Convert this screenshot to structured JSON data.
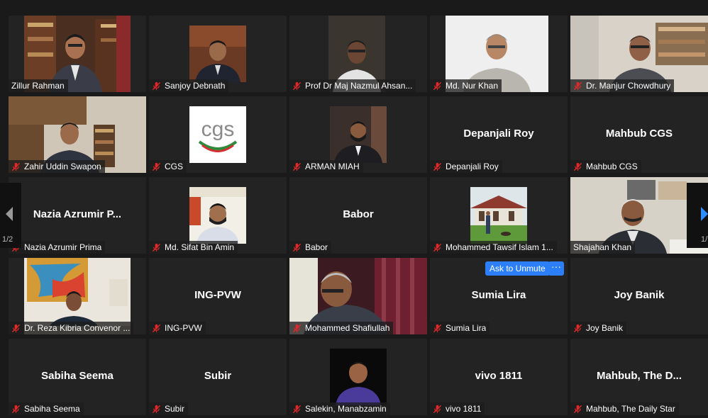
{
  "participants": [
    {
      "name": "Zillur Rahman",
      "muted": false,
      "video": "bookshelf"
    },
    {
      "name": "Sanjoy Debnath",
      "muted": true,
      "video": "portrait"
    },
    {
      "name": "Prof Dr Maj Nazmul Ahsan...",
      "muted": true,
      "video": "dark"
    },
    {
      "name": "Md. Nur Khan",
      "muted": true,
      "video": "light"
    },
    {
      "name": "Dr. Manjur Chowdhury",
      "muted": true,
      "video": "room"
    },
    {
      "name": "Zahir Uddin Swapon",
      "muted": true,
      "video": "bookshelf2"
    },
    {
      "name": "CGS",
      "muted": true,
      "video": "logo"
    },
    {
      "name": "ARMAN MIAH",
      "muted": true,
      "video": "portrait2"
    },
    {
      "name": "Depanjali Roy",
      "display_name": "Depanjali Roy",
      "muted": true
    },
    {
      "name": "Mahbub CGS",
      "display_name": "Mahbub CGS",
      "muted": true
    },
    {
      "name": "Nazia Azrumir Prima",
      "display_name": "Nazia Azrumir P...",
      "muted": true
    },
    {
      "name": "Md. Sifat Bin Amin",
      "muted": true,
      "video": "banner"
    },
    {
      "name": "Babor",
      "display_name": "Babor",
      "muted": true
    },
    {
      "name": "Mohammed Tawsif Islam 1...",
      "muted": true,
      "video": "outdoor"
    },
    {
      "name": "Shajahan Khan",
      "muted": false,
      "video": "office",
      "active": true
    },
    {
      "name": "Dr. Reza Kibria Convenor ...",
      "muted": true,
      "video": "painting"
    },
    {
      "name": "ING-PVW",
      "display_name": "ING-PVW",
      "muted": true
    },
    {
      "name": "Mohammed Shafiullah",
      "muted": true,
      "video": "curtain"
    },
    {
      "name": "Sumia Lira",
      "display_name": "Sumia Lira",
      "muted": true,
      "hover": true
    },
    {
      "name": "Joy Banik",
      "display_name": "Joy Banik",
      "muted": true
    },
    {
      "name": "Sabiha Seema",
      "display_name": "Sabiha Seema",
      "muted": true
    },
    {
      "name": "Subir",
      "display_name": "Subir",
      "muted": true
    },
    {
      "name": "Salekin, Manabzamin",
      "muted": true,
      "video": "portrait3"
    },
    {
      "name": "vivo 1811",
      "display_name": "vivo 1811",
      "muted": true
    },
    {
      "name": "Mahbub, The Daily Star",
      "display_name": "Mahbub, The D...",
      "muted": true
    }
  ],
  "logo_text": "cgs",
  "hover_actions": {
    "ask_to_unmute": "Ask to Unmute",
    "more": "···"
  },
  "pager": {
    "left": "1/2",
    "right": "1/"
  },
  "colors": {
    "active_border": "#c8d95a",
    "button_blue": "#2d7ff9",
    "mute_red": "#e02828"
  }
}
